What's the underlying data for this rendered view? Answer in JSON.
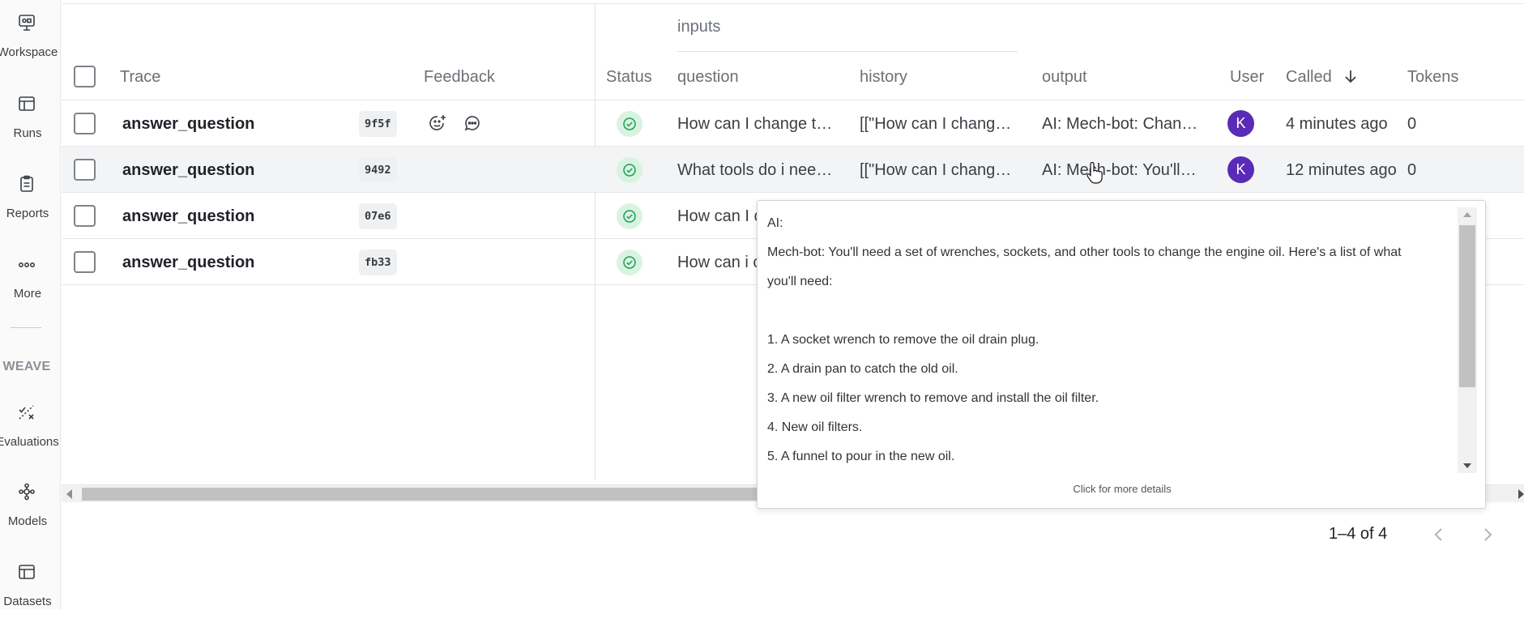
{
  "sidebar": {
    "items": [
      {
        "label": "Workspace",
        "icon": "workspace-icon"
      },
      {
        "label": "Runs",
        "icon": "runs-table-icon"
      },
      {
        "label": "Reports",
        "icon": "reports-clipboard-icon"
      },
      {
        "label": "More",
        "icon": "more-dots-icon"
      }
    ],
    "section_label": "WEAVE",
    "weave_items": [
      {
        "label": "Evaluations",
        "icon": "evaluations-icon"
      },
      {
        "label": "Models",
        "icon": "models-icon"
      },
      {
        "label": "Datasets",
        "icon": "datasets-icon"
      }
    ]
  },
  "table": {
    "group_header": "inputs",
    "columns": {
      "trace": "Trace",
      "feedback": "Feedback",
      "status": "Status",
      "question": "question",
      "history": "history",
      "output": "output",
      "user": "User",
      "called": "Called",
      "tokens": "Tokens"
    },
    "sort": {
      "column": "Called",
      "direction": "descending"
    },
    "rows": [
      {
        "name": "answer_question",
        "hash": "9f5f",
        "question": "How can I change t…",
        "history": "[[\"How can I chang…",
        "output": "AI: Mech-bot: Chan…",
        "user": "K",
        "called": "4 minutes ago",
        "tokens": "0"
      },
      {
        "name": "answer_question",
        "hash": "9492",
        "question": "What tools do i nee…",
        "history": "[[\"How can I chang…",
        "output": "AI: Mech-bot: You'll…",
        "user": "K",
        "called": "12 minutes ago",
        "tokens": "0"
      },
      {
        "name": "answer_question",
        "hash": "07e6",
        "question": "How can I c",
        "history": "",
        "output": "",
        "user": "",
        "called": "",
        "tokens": ""
      },
      {
        "name": "answer_question",
        "hash": "fb33",
        "question": "How can i c",
        "history": "",
        "output": "",
        "user": "",
        "called": "",
        "tokens": ""
      }
    ]
  },
  "popover": {
    "lines": [
      "AI:",
      "Mech-bot: You'll need a set of wrenches, sockets, and other tools to change the engine oil. Here's a list of what",
      "you'll need:",
      "",
      "1. A socket wrench to remove the oil drain plug.",
      "2. A drain pan to catch the old oil.",
      "3. A new oil filter wrench to remove and install the oil filter.",
      "4. New oil filters.",
      "5. A funnel to pour in the new oil."
    ],
    "footer": "Click for more details"
  },
  "pagination": {
    "range_text": "1–4 of 4"
  },
  "colors": {
    "avatar": "#5a2bb6",
    "status_success_bg": "#d9f3e1",
    "status_success_icon": "#1e9e56"
  }
}
